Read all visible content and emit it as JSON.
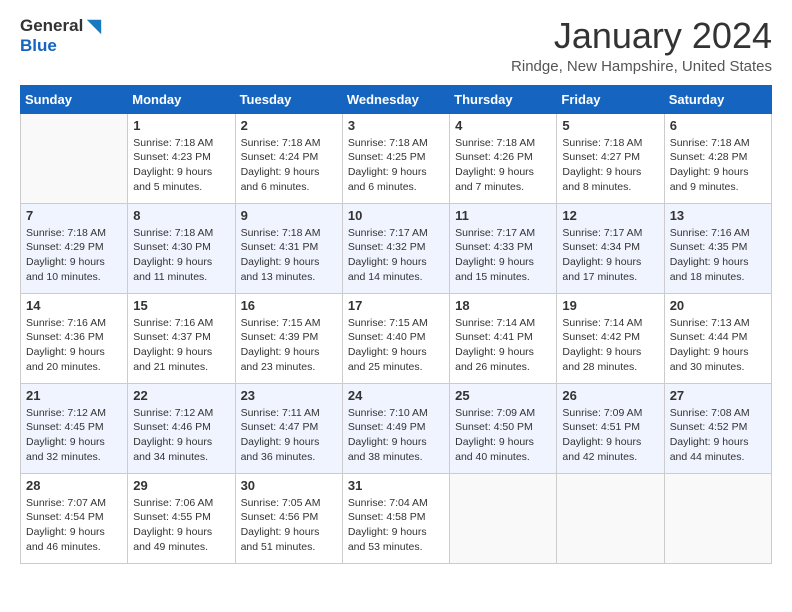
{
  "header": {
    "logo_line1": "General",
    "logo_line2": "Blue",
    "month": "January 2024",
    "location": "Rindge, New Hampshire, United States"
  },
  "weekdays": [
    "Sunday",
    "Monday",
    "Tuesday",
    "Wednesday",
    "Thursday",
    "Friday",
    "Saturday"
  ],
  "weeks": [
    [
      {
        "day": "",
        "empty": true
      },
      {
        "day": "1",
        "sunrise": "7:18 AM",
        "sunset": "4:23 PM",
        "daylight": "9 hours and 5 minutes."
      },
      {
        "day": "2",
        "sunrise": "7:18 AM",
        "sunset": "4:24 PM",
        "daylight": "9 hours and 6 minutes."
      },
      {
        "day": "3",
        "sunrise": "7:18 AM",
        "sunset": "4:25 PM",
        "daylight": "9 hours and 6 minutes."
      },
      {
        "day": "4",
        "sunrise": "7:18 AM",
        "sunset": "4:26 PM",
        "daylight": "9 hours and 7 minutes."
      },
      {
        "day": "5",
        "sunrise": "7:18 AM",
        "sunset": "4:27 PM",
        "daylight": "9 hours and 8 minutes."
      },
      {
        "day": "6",
        "sunrise": "7:18 AM",
        "sunset": "4:28 PM",
        "daylight": "9 hours and 9 minutes."
      }
    ],
    [
      {
        "day": "7",
        "sunrise": "7:18 AM",
        "sunset": "4:29 PM",
        "daylight": "9 hours and 10 minutes."
      },
      {
        "day": "8",
        "sunrise": "7:18 AM",
        "sunset": "4:30 PM",
        "daylight": "9 hours and 11 minutes."
      },
      {
        "day": "9",
        "sunrise": "7:18 AM",
        "sunset": "4:31 PM",
        "daylight": "9 hours and 13 minutes."
      },
      {
        "day": "10",
        "sunrise": "7:17 AM",
        "sunset": "4:32 PM",
        "daylight": "9 hours and 14 minutes."
      },
      {
        "day": "11",
        "sunrise": "7:17 AM",
        "sunset": "4:33 PM",
        "daylight": "9 hours and 15 minutes."
      },
      {
        "day": "12",
        "sunrise": "7:17 AM",
        "sunset": "4:34 PM",
        "daylight": "9 hours and 17 minutes."
      },
      {
        "day": "13",
        "sunrise": "7:16 AM",
        "sunset": "4:35 PM",
        "daylight": "9 hours and 18 minutes."
      }
    ],
    [
      {
        "day": "14",
        "sunrise": "7:16 AM",
        "sunset": "4:36 PM",
        "daylight": "9 hours and 20 minutes."
      },
      {
        "day": "15",
        "sunrise": "7:16 AM",
        "sunset": "4:37 PM",
        "daylight": "9 hours and 21 minutes."
      },
      {
        "day": "16",
        "sunrise": "7:15 AM",
        "sunset": "4:39 PM",
        "daylight": "9 hours and 23 minutes."
      },
      {
        "day": "17",
        "sunrise": "7:15 AM",
        "sunset": "4:40 PM",
        "daylight": "9 hours and 25 minutes."
      },
      {
        "day": "18",
        "sunrise": "7:14 AM",
        "sunset": "4:41 PM",
        "daylight": "9 hours and 26 minutes."
      },
      {
        "day": "19",
        "sunrise": "7:14 AM",
        "sunset": "4:42 PM",
        "daylight": "9 hours and 28 minutes."
      },
      {
        "day": "20",
        "sunrise": "7:13 AM",
        "sunset": "4:44 PM",
        "daylight": "9 hours and 30 minutes."
      }
    ],
    [
      {
        "day": "21",
        "sunrise": "7:12 AM",
        "sunset": "4:45 PM",
        "daylight": "9 hours and 32 minutes."
      },
      {
        "day": "22",
        "sunrise": "7:12 AM",
        "sunset": "4:46 PM",
        "daylight": "9 hours and 34 minutes."
      },
      {
        "day": "23",
        "sunrise": "7:11 AM",
        "sunset": "4:47 PM",
        "daylight": "9 hours and 36 minutes."
      },
      {
        "day": "24",
        "sunrise": "7:10 AM",
        "sunset": "4:49 PM",
        "daylight": "9 hours and 38 minutes."
      },
      {
        "day": "25",
        "sunrise": "7:09 AM",
        "sunset": "4:50 PM",
        "daylight": "9 hours and 40 minutes."
      },
      {
        "day": "26",
        "sunrise": "7:09 AM",
        "sunset": "4:51 PM",
        "daylight": "9 hours and 42 minutes."
      },
      {
        "day": "27",
        "sunrise": "7:08 AM",
        "sunset": "4:52 PM",
        "daylight": "9 hours and 44 minutes."
      }
    ],
    [
      {
        "day": "28",
        "sunrise": "7:07 AM",
        "sunset": "4:54 PM",
        "daylight": "9 hours and 46 minutes."
      },
      {
        "day": "29",
        "sunrise": "7:06 AM",
        "sunset": "4:55 PM",
        "daylight": "9 hours and 49 minutes."
      },
      {
        "day": "30",
        "sunrise": "7:05 AM",
        "sunset": "4:56 PM",
        "daylight": "9 hours and 51 minutes."
      },
      {
        "day": "31",
        "sunrise": "7:04 AM",
        "sunset": "4:58 PM",
        "daylight": "9 hours and 53 minutes."
      },
      {
        "day": "",
        "empty": true
      },
      {
        "day": "",
        "empty": true
      },
      {
        "day": "",
        "empty": true
      }
    ]
  ],
  "labels": {
    "sunrise": "Sunrise:",
    "sunset": "Sunset:",
    "daylight": "Daylight:"
  }
}
